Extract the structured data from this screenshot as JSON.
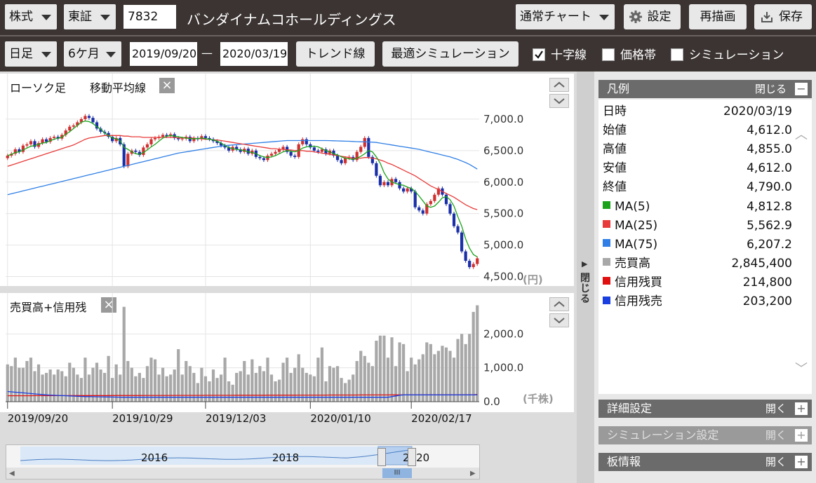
{
  "toolbar1": {
    "market_type": "株式",
    "exchange": "東証",
    "code": "7832",
    "company": "バンダイナムコホールディングス",
    "chart_mode": "通常チャート",
    "settings": "設定",
    "redraw": "再描画",
    "save": "保存"
  },
  "toolbar2": {
    "period_type": "日足",
    "range": "6ケ月",
    "date_from": "2019/09/20",
    "dash": "—",
    "date_to": "2020/03/19",
    "trendline": "トレンド線",
    "optimal_sim": "最適シミュレーション",
    "crosshair": "十字線",
    "price_band": "価格帯",
    "simulation": "シミュレーション"
  },
  "price_panel": {
    "title_candle": "ローソク足",
    "title_ma": "移動平均線",
    "close": "×",
    "unit": "(円)"
  },
  "volume_panel": {
    "title": "売買高+信用残",
    "close": "×",
    "unit": "(千株)"
  },
  "side_toggle": "閉じる",
  "legend": {
    "title": "凡例",
    "close_label": "閉じる",
    "minus": "−",
    "rows": [
      {
        "key": "日時",
        "value": "2020/03/19",
        "color": ""
      },
      {
        "key": "始値",
        "value": "4,612.0",
        "color": ""
      },
      {
        "key": "高値",
        "value": "4,855.0",
        "color": ""
      },
      {
        "key": "安値",
        "value": "4,612.0",
        "color": ""
      },
      {
        "key": "終値",
        "value": "4,790.0",
        "color": ""
      },
      {
        "key": "MA(5)",
        "value": "4,812.8",
        "color": "#1aa31a"
      },
      {
        "key": "MA(25)",
        "value": "5,562.9",
        "color": "#e83a3a"
      },
      {
        "key": "MA(75)",
        "value": "6,207.2",
        "color": "#2f7fe6"
      },
      {
        "key": "売買高",
        "value": "2,845,400",
        "color": "#a8a8a8"
      },
      {
        "key": "信用残買",
        "value": "214,800",
        "color": "#e01010"
      },
      {
        "key": "信用残売",
        "value": "203,200",
        "color": "#1a3fe0"
      }
    ]
  },
  "sections": [
    {
      "title": "詳細設定",
      "action": "開く",
      "sign": "+"
    },
    {
      "title": "シミュレーション設定",
      "action": "開く",
      "sign": "+"
    },
    {
      "title": "板情報",
      "action": "開く",
      "sign": "+"
    }
  ],
  "navigator": {
    "labels": [
      "2016",
      "2018",
      "2020"
    ],
    "thumb": "III"
  },
  "colors": {
    "up": "#d03030",
    "down": "#1a2fa8",
    "ma5": "#1aa31a",
    "ma25": "#e83a3a",
    "ma75": "#2f7fe6",
    "volume": "#a8a8a8",
    "margin_buy": "#e01010",
    "margin_sell": "#1a3fe0"
  },
  "chart_data": [
    {
      "type": "candlestick",
      "title": "ローソク足 移動平均線",
      "ylabel": "(円)",
      "ylim": [
        4350,
        7500
      ],
      "yticks": [
        "7,000.0",
        "6,500.0",
        "6,000.0",
        "5,500.0",
        "5,000.0",
        "4,500.0"
      ],
      "xticks": [
        "2019/09/20",
        "2019/10/29",
        "2019/12/03",
        "2020/01/10",
        "2020/02/17"
      ],
      "close": [
        6420,
        6450,
        6520,
        6480,
        6580,
        6600,
        6650,
        6560,
        6620,
        6680,
        6640,
        6700,
        6720,
        6690,
        6750,
        6820,
        6880,
        6900,
        6950,
        7000,
        7050,
        7020,
        6950,
        6850,
        6800,
        6780,
        6720,
        6650,
        6700,
        6600,
        6250,
        6450,
        6500,
        6480,
        6430,
        6550,
        6600,
        6680,
        6700,
        6720,
        6750,
        6730,
        6760,
        6700,
        6680,
        6690,
        6720,
        6650,
        6700,
        6680,
        6730,
        6700,
        6680,
        6650,
        6620,
        6580,
        6550,
        6500,
        6560,
        6520,
        6480,
        6530,
        6450,
        6500,
        6400,
        6380,
        6350,
        6420,
        6450,
        6480,
        6520,
        6560,
        6480,
        6420,
        6400,
        6600,
        6680,
        6600,
        6550,
        6500,
        6480,
        6520,
        6450,
        6500,
        6420,
        6350,
        6300,
        6380,
        6400,
        6350,
        6480,
        6560,
        6700,
        6400,
        6300,
        6100,
        5950,
        6000,
        5950,
        6050,
        6000,
        5900,
        5850,
        5900,
        5850,
        5600,
        5550,
        5500,
        5650,
        5700,
        5800,
        5900,
        5800,
        5650,
        5500,
        5300,
        5200,
        4900,
        4750,
        4650,
        4700,
        4790
      ],
      "ma5": [
        6420,
        6440,
        6470,
        6480,
        6510,
        6540,
        6570,
        6580,
        6600,
        6620,
        6630,
        6660,
        6680,
        6700,
        6710,
        6760,
        6800,
        6850,
        6900,
        6950,
        6970,
        6960,
        6930,
        6880,
        6840,
        6780,
        6740,
        6700,
        6690,
        6660,
        6550,
        6520,
        6480,
        6450,
        6440,
        6470,
        6510,
        6560,
        6600,
        6650,
        6700,
        6730,
        6740,
        6730,
        6720,
        6710,
        6700,
        6690,
        6690,
        6690,
        6700,
        6690,
        6680,
        6670,
        6650,
        6620,
        6580,
        6550,
        6530,
        6520,
        6510,
        6500,
        6480,
        6470,
        6450,
        6420,
        6400,
        6390,
        6400,
        6420,
        6450,
        6480,
        6500,
        6490,
        6480,
        6500,
        6540,
        6560,
        6570,
        6570,
        6560,
        6530,
        6500,
        6480,
        6450,
        6430,
        6400,
        6380,
        6370,
        6360,
        6380,
        6410,
        6450,
        6500,
        6480,
        6400,
        6300,
        6150,
        6050,
        6000,
        5980,
        5960,
        5950,
        5920,
        5900,
        5850,
        5780,
        5700,
        5620,
        5600,
        5620,
        5680,
        5750,
        5770,
        5720,
        5620,
        5450,
        5300,
        5100,
        4950,
        4850,
        4813
      ],
      "ma25": [
        6250,
        6270,
        6290,
        6310,
        6330,
        6350,
        6370,
        6390,
        6410,
        6430,
        6450,
        6470,
        6490,
        6510,
        6530,
        6550,
        6570,
        6590,
        6620,
        6650,
        6680,
        6700,
        6710,
        6720,
        6730,
        6740,
        6740,
        6740,
        6740,
        6740,
        6730,
        6730,
        6720,
        6720,
        6720,
        6710,
        6710,
        6710,
        6710,
        6710,
        6710,
        6710,
        6710,
        6710,
        6700,
        6700,
        6700,
        6700,
        6700,
        6690,
        6690,
        6680,
        6680,
        6670,
        6670,
        6660,
        6650,
        6640,
        6630,
        6620,
        6610,
        6600,
        6590,
        6580,
        6570,
        6560,
        6550,
        6540,
        6530,
        6530,
        6520,
        6520,
        6510,
        6510,
        6500,
        6500,
        6500,
        6490,
        6490,
        6480,
        6470,
        6460,
        6450,
        6440,
        6430,
        6420,
        6410,
        6400,
        6390,
        6380,
        6380,
        6380,
        6390,
        6390,
        6380,
        6370,
        6350,
        6330,
        6300,
        6280,
        6250,
        6220,
        6190,
        6160,
        6130,
        6100,
        6060,
        6020,
        5980,
        5940,
        5910,
        5880,
        5850,
        5820,
        5790,
        5760,
        5720,
        5680,
        5640,
        5610,
        5580,
        5563
      ],
      "ma75": [
        5800,
        5815,
        5830,
        5845,
        5860,
        5875,
        5890,
        5905,
        5920,
        5935,
        5950,
        5965,
        5980,
        5995,
        6010,
        6025,
        6040,
        6055,
        6070,
        6085,
        6100,
        6115,
        6130,
        6145,
        6160,
        6175,
        6190,
        6205,
        6220,
        6235,
        6250,
        6265,
        6280,
        6295,
        6310,
        6325,
        6340,
        6355,
        6370,
        6385,
        6400,
        6415,
        6430,
        6445,
        6460,
        6470,
        6480,
        6490,
        6500,
        6510,
        6520,
        6530,
        6540,
        6550,
        6560,
        6570,
        6580,
        6585,
        6590,
        6595,
        6600,
        6605,
        6610,
        6615,
        6620,
        6625,
        6630,
        6635,
        6640,
        6645,
        6650,
        6655,
        6660,
        6660,
        6660,
        6660,
        6660,
        6660,
        6660,
        6660,
        6660,
        6660,
        6660,
        6658,
        6656,
        6654,
        6652,
        6650,
        6648,
        6645,
        6642,
        6640,
        6638,
        6636,
        6634,
        6630,
        6620,
        6610,
        6600,
        6590,
        6580,
        6570,
        6560,
        6550,
        6540,
        6530,
        6520,
        6505,
        6490,
        6475,
        6460,
        6445,
        6430,
        6415,
        6400,
        6380,
        6360,
        6335,
        6310,
        6280,
        6245,
        6207
      ]
    },
    {
      "type": "bar",
      "title": "売買高+信用残",
      "ylabel": "(千株)",
      "ylim": [
        0,
        3000
      ],
      "yticks": [
        "2,000.0",
        "1,000.0",
        "0.0"
      ],
      "xticks": [
        "2019/09/20",
        "2019/10/29",
        "2019/12/03",
        "2020/01/10",
        "2020/02/17"
      ],
      "volume": [
        1100,
        1050,
        1300,
        1000,
        1000,
        1200,
        1300,
        900,
        1100,
        800,
        850,
        950,
        800,
        950,
        900,
        750,
        1150,
        1000,
        800,
        700,
        1300,
        800,
        1000,
        1150,
        950,
        850,
        1350,
        700,
        1100,
        800,
        2800,
        1200,
        1000,
        750,
        850,
        700,
        1050,
        1300,
        1250,
        800,
        1000,
        750,
        800,
        950,
        1550,
        800,
        1200,
        1050,
        850,
        550,
        1000,
        750,
        600,
        950,
        700,
        800,
        1300,
        600,
        500,
        850,
        900,
        1200,
        800,
        1250,
        850,
        1050,
        900,
        1300,
        800,
        600,
        650,
        1150,
        1300,
        850,
        1000,
        1400,
        1000,
        850,
        800,
        750,
        1300,
        1600,
        600,
        1050,
        1000,
        1050,
        700,
        550,
        650,
        800,
        1200,
        1500,
        1350,
        1150,
        1050,
        1800,
        1950,
        1950,
        1300,
        1900,
        1050,
        1750,
        1700,
        900,
        1300,
        1100,
        1250,
        1400,
        1750,
        1700,
        1400,
        1500,
        1650,
        1600,
        1500,
        1300,
        1850,
        2000,
        1700,
        2000,
        2650,
        2845
      ],
      "margin_buy": [
        175,
        175,
        175,
        176,
        176,
        176,
        176,
        177,
        177,
        177,
        177,
        178,
        178,
        178,
        178,
        178,
        179,
        179,
        179,
        180,
        180,
        180,
        180,
        181,
        181,
        181,
        181,
        182,
        182,
        182,
        182,
        183,
        183,
        183,
        183,
        184,
        184,
        184,
        184,
        185,
        185,
        185,
        185,
        186,
        186,
        186,
        186,
        187,
        187,
        187,
        187,
        188,
        188,
        188,
        188,
        189,
        189,
        189,
        189,
        190,
        190,
        190,
        190,
        191,
        191,
        191,
        191,
        192,
        192,
        192,
        192,
        193,
        193,
        193,
        193,
        194,
        194,
        194,
        194,
        195,
        195,
        195,
        195,
        196,
        196,
        196,
        196,
        197,
        197,
        197,
        197,
        198,
        198,
        198,
        198,
        199,
        199,
        199,
        199,
        200,
        200,
        200,
        200,
        201,
        201,
        201,
        201,
        202,
        202,
        202,
        202,
        203,
        203,
        203,
        203,
        204,
        204,
        204,
        204,
        205,
        205,
        215
      ],
      "margin_sell": [
        300,
        290,
        280,
        270,
        260,
        250,
        240,
        230,
        220,
        210,
        200,
        195,
        190,
        185,
        180,
        175,
        170,
        165,
        160,
        155,
        150,
        148,
        146,
        144,
        142,
        140,
        138,
        136,
        134,
        132,
        130,
        130,
        130,
        130,
        130,
        130,
        130,
        130,
        130,
        130,
        130,
        130,
        130,
        130,
        130,
        130,
        130,
        130,
        130,
        130,
        130,
        130,
        130,
        130,
        130,
        130,
        130,
        130,
        130,
        130,
        130,
        130,
        130,
        130,
        130,
        130,
        130,
        130,
        130,
        130,
        130,
        130,
        130,
        130,
        130,
        130,
        130,
        130,
        130,
        130,
        130,
        130,
        130,
        130,
        130,
        130,
        130,
        130,
        130,
        130,
        130,
        130,
        130,
        130,
        130,
        130,
        130,
        130,
        130,
        150,
        170,
        190,
        200,
        200,
        200,
        200,
        200,
        200,
        200,
        200,
        200,
        200,
        200,
        200,
        200,
        200,
        200,
        200,
        200,
        200,
        200,
        203
      ]
    }
  ]
}
